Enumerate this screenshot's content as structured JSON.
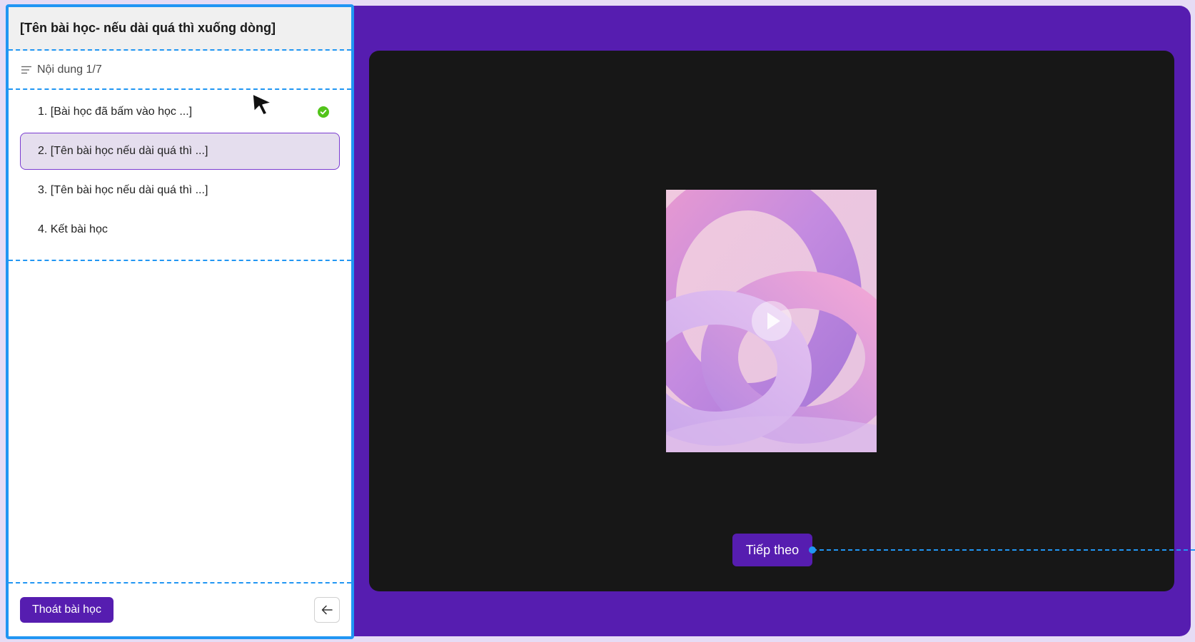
{
  "sidebar": {
    "title": "[Tên bài học- nếu dài quá thì xuống dòng]",
    "progress_label": "Nội dung 1/7",
    "lessons": [
      {
        "label": "1. [Bài học đã bấm vào học ...]",
        "completed": true
      },
      {
        "label": "2. [Tên bài học nếu dài quá thì ...]",
        "active": true
      },
      {
        "label": "3. [Tên bài học nếu dài quá thì ...]"
      },
      {
        "label": "4. Kết bài học"
      }
    ],
    "exit_label": "Thoát bài học"
  },
  "player": {
    "next_label": "Tiếp theo"
  },
  "colors": {
    "brand_purple": "#561db0",
    "selection_border": "#2196f3",
    "completed_green": "#52c41a",
    "player_bg": "#171717"
  },
  "icons": {
    "list": "list-icon",
    "completed": "check-circle-icon",
    "play": "play-icon",
    "collapse": "arrow-left-icon",
    "cursor": "mouse-cursor-icon"
  }
}
